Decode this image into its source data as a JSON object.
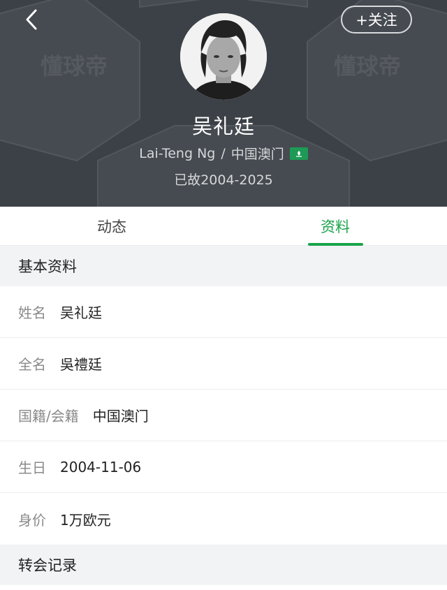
{
  "header": {
    "follow_label": "+关注",
    "player_name": "吴礼廷",
    "english_name": "Lai-Teng Ng",
    "separator": "/",
    "nationality": "中国澳门",
    "lifespan": "已故2004-2025",
    "watermark_text": "懂球帝",
    "bg_color": "#3c4147"
  },
  "tabs": [
    {
      "label": "动态",
      "active": false
    },
    {
      "label": "资料",
      "active": true
    }
  ],
  "accent_color": "#1aa34a",
  "basic_info": {
    "title": "基本资料",
    "rows": [
      {
        "label": "姓名",
        "value": "吴礼廷"
      },
      {
        "label": "全名",
        "value": "吳禮廷"
      },
      {
        "label": "国籍/会籍",
        "value": "中国澳门"
      },
      {
        "label": "生日",
        "value": "2004-11-06"
      },
      {
        "label": "身价",
        "value": "1万欧元"
      }
    ]
  },
  "transfer": {
    "title": "转会记录"
  },
  "icons": {
    "back": "chevron-left-icon",
    "flag": "macau-flag-icon",
    "avatar": "player-avatar"
  }
}
